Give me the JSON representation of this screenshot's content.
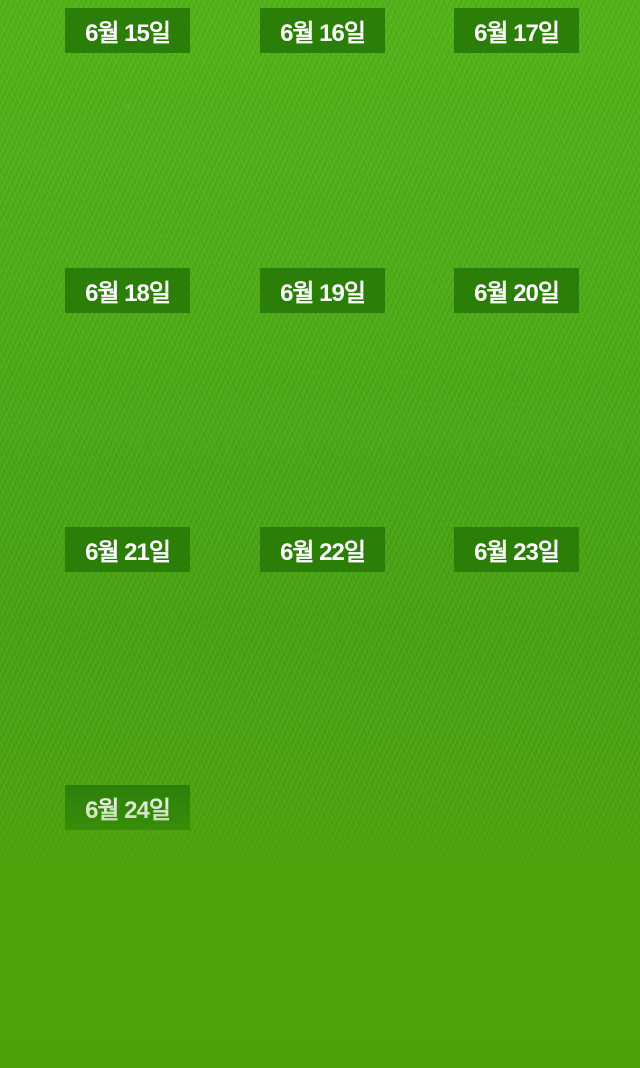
{
  "background": {
    "type": "grass-field",
    "colors": {
      "grass_light": "#4fb313",
      "grass_dark": "#44a10d",
      "bottom": "#4da20a",
      "tab": "#2b7f09",
      "tab_text": "#ffffff"
    }
  },
  "dates": [
    {
      "label": "6월 15일"
    },
    {
      "label": "6월 16일"
    },
    {
      "label": "6월 17일"
    },
    {
      "label": "6월 18일"
    },
    {
      "label": "6월 19일"
    },
    {
      "label": "6월 20일"
    },
    {
      "label": "6월 21일"
    },
    {
      "label": "6월 22일"
    },
    {
      "label": "6월 23일"
    },
    {
      "label": "6월 24일"
    }
  ]
}
